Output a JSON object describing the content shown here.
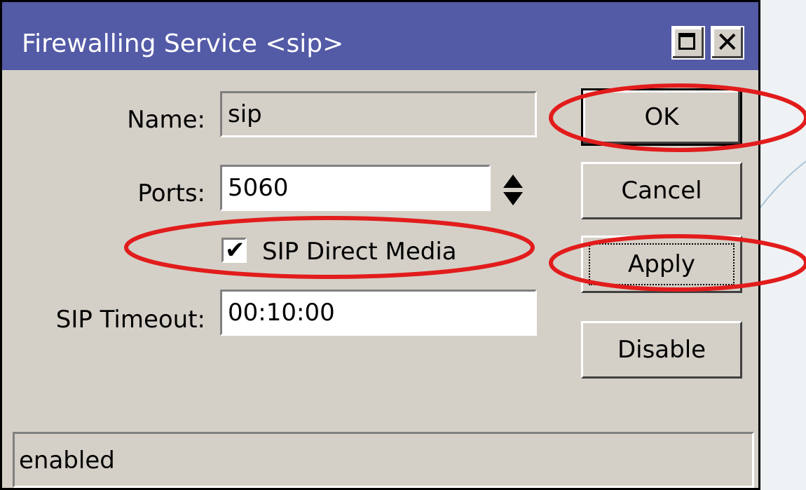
{
  "window": {
    "title": "Firewalling Service <sip>",
    "controls": {
      "maximize_icon": "maximize-icon",
      "close_icon": "close-icon"
    }
  },
  "form": {
    "name": {
      "label": "Name:",
      "value": "sip"
    },
    "ports": {
      "label": "Ports:",
      "value": "5060",
      "icon": "spinner-arrows-icon"
    },
    "sip_direct_media": {
      "label": "SIP Direct Media",
      "checked": true
    },
    "sip_timeout": {
      "label": "SIP Timeout:",
      "value": "00:10:00"
    }
  },
  "buttons": {
    "ok": "OK",
    "cancel": "Cancel",
    "apply": "Apply",
    "disable": "Disable"
  },
  "status": {
    "text": "enabled"
  },
  "colors": {
    "titlebar": "#535aa6",
    "dialog_bg": "#d4d0c8",
    "annotation": "#e21c1c"
  }
}
